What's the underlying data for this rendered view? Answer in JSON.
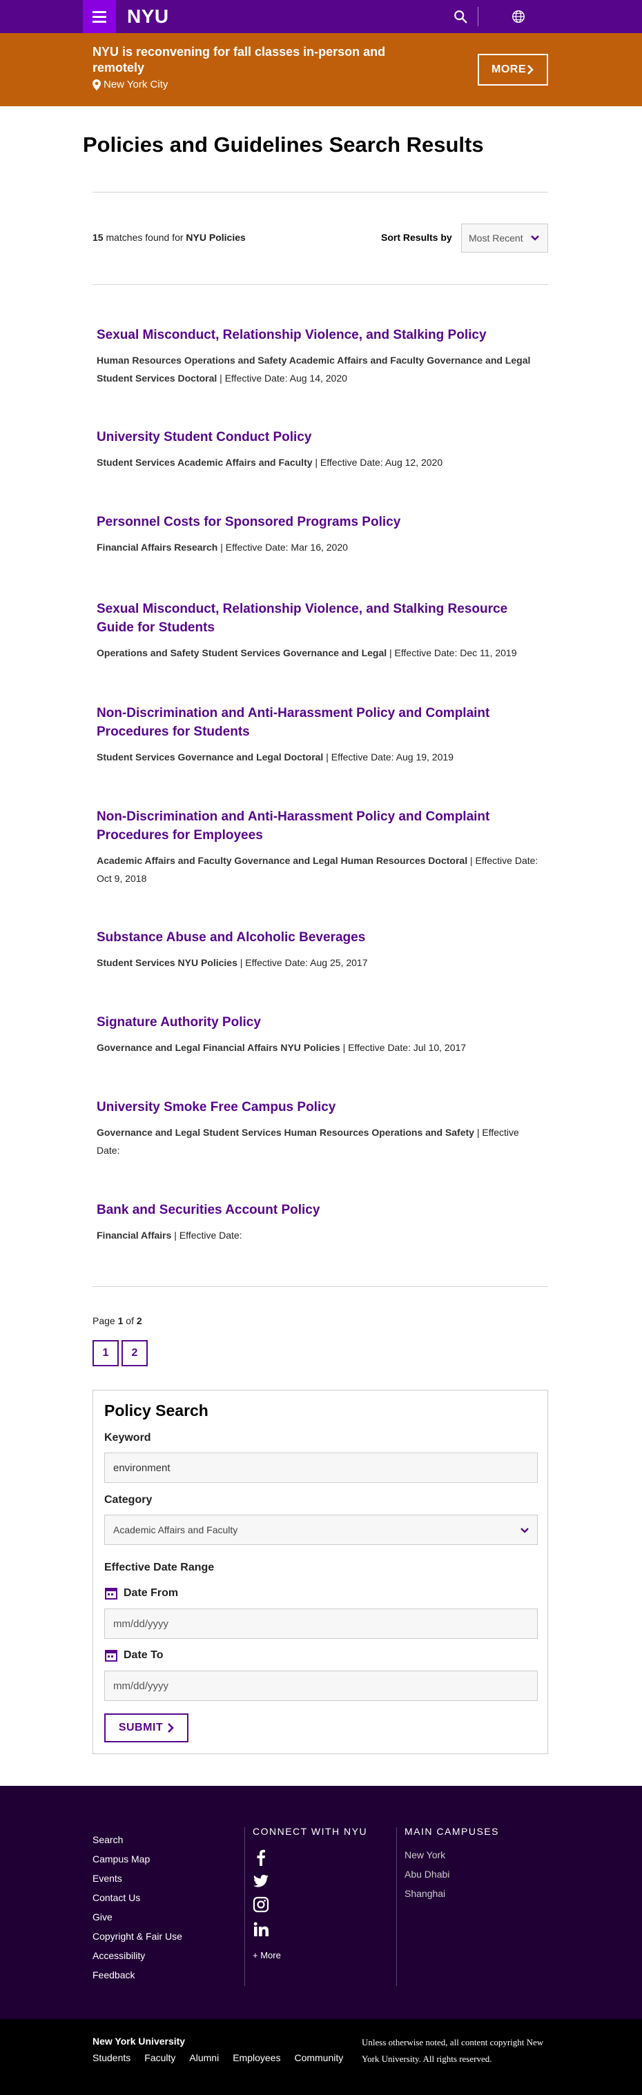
{
  "header": {
    "logo": "NYU",
    "menu_icon": "hamburger-menu-icon",
    "search_icon": "search-icon",
    "globe_icon": "globe-icon"
  },
  "banner": {
    "title": "NYU is reconvening for fall classes in-person and remotely",
    "location": "New York City",
    "more_label": "MORE"
  },
  "page": {
    "title": "Policies and Guidelines Search Results",
    "match_count": "15",
    "match_text": "matches found for",
    "match_query": "NYU Policies",
    "sort_label": "Sort Results by",
    "sort_value": "Most Recent"
  },
  "results": [
    {
      "title": "Sexual Misconduct, Relationship Violence, and Stalking Policy",
      "categories": "Human Resources Operations and Safety Academic Affairs and Faculty Governance and Legal Student Services Doctoral",
      "date": "| Effective Date: Aug 14, 2020"
    },
    {
      "title": "University Student Conduct Policy",
      "categories": "Student Services Academic Affairs and Faculty",
      "date": "| Effective Date: Aug 12, 2020"
    },
    {
      "title": "Personnel Costs for Sponsored Programs Policy",
      "categories": "Financial Affairs Research",
      "date": "| Effective Date: Mar 16, 2020"
    },
    {
      "title": "Sexual Misconduct, Relationship Violence, and Stalking Resource Guide for Students",
      "categories": "Operations and Safety Student Services Governance and Legal",
      "date": "| Effective Date: Dec 11, 2019"
    },
    {
      "title": "Non-Discrimination and Anti-Harassment Policy and Complaint Procedures for Students",
      "categories": "Student Services Governance and Legal Doctoral",
      "date": "| Effective Date: Aug 19, 2019"
    },
    {
      "title": "Non-Discrimination and Anti-Harassment Policy and Complaint Procedures for Employees",
      "categories": "Academic Affairs and Faculty Governance and Legal Human Resources Doctoral",
      "date": "| Effective Date: Oct 9, 2018"
    },
    {
      "title": "Substance Abuse and Alcoholic Beverages",
      "categories": "Student Services NYU Policies",
      "date": "| Effective Date: Aug 25, 2017"
    },
    {
      "title": "Signature Authority Policy",
      "categories": "Governance and Legal Financial Affairs NYU Policies",
      "date": "| Effective Date: Jul 10, 2017"
    },
    {
      "title": "University Smoke Free Campus Policy",
      "categories": "Governance and Legal Student Services Human Resources Operations and Safety",
      "date": "| Effective Date:"
    },
    {
      "title": "Bank and Securities Account Policy",
      "categories": "Financial Affairs",
      "date": "| Effective Date:"
    }
  ],
  "pagination": {
    "page_word": "Page",
    "current": "1",
    "of_word": "of",
    "total": "2",
    "pages": [
      "1",
      "2"
    ]
  },
  "policy_search": {
    "title": "Policy Search",
    "keyword_label": "Keyword",
    "keyword_value": "environment",
    "category_label": "Category",
    "category_value": "Academic Affairs and Faculty",
    "date_range_label": "Effective Date Range",
    "date_from_label": "Date From",
    "date_from_placeholder": "mm/dd/yyyy",
    "date_to_label": "Date To",
    "date_to_placeholder": "mm/dd/yyyy",
    "submit_label": "SUBMIT"
  },
  "footer": {
    "links": [
      "Search",
      "Campus Map",
      "Events",
      "Contact Us",
      "Give",
      "Copyright & Fair Use",
      "Accessibility",
      "Feedback"
    ],
    "connect_heading": "CONNECT WITH NYU",
    "social_icons": [
      "facebook-icon",
      "twitter-icon",
      "instagram-icon",
      "linkedin-icon"
    ],
    "more_label": "+ More",
    "campuses_heading": "MAIN CAMPUSES",
    "campuses": [
      "New York",
      "Abu Dhabi",
      "Shanghai"
    ]
  },
  "bottom": {
    "name": "New York University",
    "links": [
      "Students",
      "Faculty",
      "Alumni",
      "Employees",
      "Community"
    ],
    "copyright": "Unless otherwise noted, all content copyright New York University. All rights reserved."
  },
  "colors": {
    "brand_purple": "#57068c",
    "menu_purple": "#8900e1",
    "banner_orange": "#c05f0b",
    "footer_dark": "#200034"
  }
}
